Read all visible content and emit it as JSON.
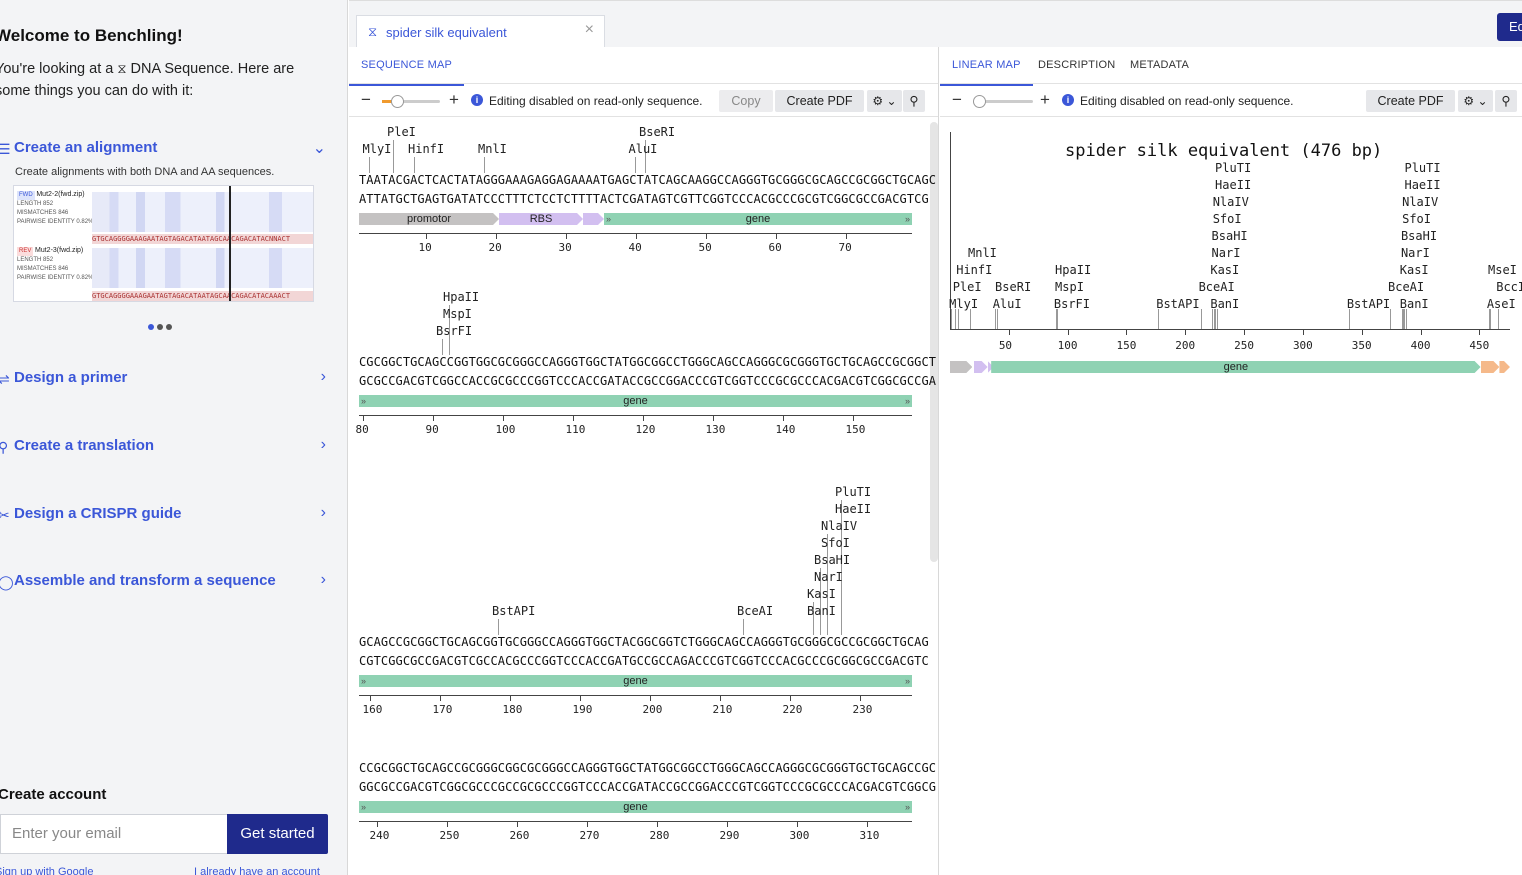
{
  "left": {
    "welcome": "Welcome to Benchling!",
    "intro_pre": "You're looking at a",
    "intro_icon": "dna-sequence-icon",
    "intro_post": "DNA Sequence. Here are some things you can do with it:",
    "workflows": [
      {
        "label": "Create an alignment",
        "expanded": true,
        "icon": "alignment-icon"
      },
      {
        "label": "Design a primer",
        "expanded": false,
        "icon": "primer-icon"
      },
      {
        "label": "Create a translation",
        "expanded": false,
        "icon": "translation-icon"
      },
      {
        "label": "Design a CRISPR guide",
        "expanded": false,
        "icon": "crispr-icon"
      },
      {
        "label": "Assemble and transform a sequence",
        "expanded": false,
        "icon": "assemble-icon"
      }
    ],
    "alignment_desc": "Create alignments with both DNA and AA sequences.",
    "alignment_preview": {
      "fwd_tag": "FWD",
      "fwd_name": "Mut2-2(fwd.zip)",
      "rev_tag": "REV",
      "rev_name": "Mut2-3(fwd.zip)",
      "length_label": "LENGTH",
      "fwd_length": "852",
      "rev_length": "852",
      "mismatches_label": "MISMATCHES",
      "fwd_mismatches": "846",
      "rev_mismatches": "846",
      "identity_label": "PAIRWISE IDENTITY",
      "fwd_identity": "0.82%",
      "rev_identity": "0.82%",
      "fwd_seq": "GTGCAGGGGAAAGAATAGTAGACATAATAGCAACAGACATACNNACT",
      "rev_seq": "GTGCAGGGGAAAGAATAGTAGACATAATAGCAACAGACATACAAACT"
    },
    "create_account": "Create account",
    "email_placeholder": "Enter your email",
    "get_started": "Get started",
    "signup_google": "Sign up with Google",
    "already": "I already have an account"
  },
  "tabs": [
    {
      "label": "spider silk equivalent",
      "icon": "dna-sequence-icon"
    }
  ],
  "edit_button": "Ed",
  "middle": {
    "subtabs": [
      "SEQUENCE MAP"
    ],
    "read_only": "Editing disabled on read-only sequence.",
    "copy": "Copy",
    "create_pdf": "Create PDF",
    "rows": [
      {
        "enzymes": [
          {
            "name": "PleI",
            "level": 1,
            "pos": 4
          },
          {
            "name": "MlyI",
            "level": 0,
            "pos": 0.5
          },
          {
            "name": "HinfI",
            "level": 0,
            "pos": 7
          },
          {
            "name": "MnlI",
            "level": 0,
            "pos": 17
          },
          {
            "name": "BseRI",
            "level": 1,
            "pos": 40
          },
          {
            "name": "AluI",
            "level": 0,
            "pos": 38.5
          }
        ],
        "top": "TAATACGACTCACTATAGGGAAAGAGGAGAAAATGAGCTATCAGCAAGGCCAGGGTGCGGGCGCAGCCGCGGCTGCAGC",
        "bottom": "ATTATGCTGAGTGATATCCCTTTCTCCTCTTTTACTCGATAGTCGTTCGGTCCCACGCCCGCGTCGGCGCCGACGTCG",
        "features": [
          {
            "label": "promotor",
            "kind": "promotor",
            "start": 0,
            "end": 20
          },
          {
            "label": "RBS",
            "kind": "rbs",
            "start": 20,
            "end": 32
          },
          {
            "label": "",
            "kind": "mini",
            "start": 32,
            "end": 35
          },
          {
            "label": "gene",
            "kind": "gene",
            "start": 35,
            "end": 79
          }
        ],
        "ticks": [
          10,
          20,
          30,
          40,
          50,
          60,
          70
        ],
        "first": 1
      },
      {
        "enzymes": [
          {
            "name": "HpaII",
            "level": 2,
            "pos": 12
          },
          {
            "name": "MspI",
            "level": 1,
            "pos": 12
          },
          {
            "name": "BsrFI",
            "level": 0,
            "pos": 11
          }
        ],
        "top": "CGCGGCTGCAGCCGGTGGCGCGGGCCAGGGTGGCTATGGCGGCCTGGGCAGCCAGGGCGCGGGTGCTGCAGCCGCGGCT",
        "bottom": "GCGCCGACGTCGGCCACCGCGCCCGGTCCCACCGATACCGCCGGACCCGTCGGTCCCGCGCCCACGACGTCGGCGCCGA",
        "features": [
          {
            "label": "gene",
            "kind": "gene",
            "start": 0,
            "end": 79
          }
        ],
        "ticks": [
          80,
          90,
          100,
          110,
          120,
          130,
          140,
          150
        ],
        "first": 80
      },
      {
        "enzymes": [
          {
            "name": "PluTI",
            "level": 7,
            "pos": 68
          },
          {
            "name": "HaeII",
            "level": 6,
            "pos": 68
          },
          {
            "name": "NlaIV",
            "level": 5,
            "pos": 66
          },
          {
            "name": "SfoI",
            "level": 4,
            "pos": 66
          },
          {
            "name": "BsaHI",
            "level": 3,
            "pos": 65
          },
          {
            "name": "NarI",
            "level": 2,
            "pos": 65
          },
          {
            "name": "KasI",
            "level": 1,
            "pos": 64
          },
          {
            "name": "BstAPI",
            "level": 0,
            "pos": 19
          },
          {
            "name": "BceAI",
            "level": 0,
            "pos": 54
          },
          {
            "name": "BanI",
            "level": 0,
            "pos": 64
          }
        ],
        "top": "GCAGCCGCGGCTGCAGCGGTGCGGGCCAGGGTGGCTACGGCGGTCTGGGCAGCCAGGGTGCGGGCGCCGCGGCTGCAG",
        "bottom": "CGTCGGCGCCGACGTCGCCACGCCCGGTCCCACCGATGCCGCCAGACCCGTCGGTCCCACGCCCGCGGCGCCGACGTC",
        "features": [
          {
            "label": "gene",
            "kind": "gene",
            "start": 0,
            "end": 79
          }
        ],
        "ticks": [
          160,
          170,
          180,
          190,
          200,
          210,
          220,
          230
        ],
        "first": 159
      },
      {
        "enzymes": [],
        "top": "CCGCGGCTGCAGCCGCGGGCGGCGCGGGCCAGGGTGGCTATGGCGGCCTGGGCAGCCAGGGCGCGGGTGCTGCAGCCGC",
        "bottom": "GGCGCCGACGTCGGCGCCCGCCGCGCCCGGTCCCACCGATACCGCCGGACCCGTCGGTCCCGCGCCCACGACGTCGGCG",
        "features": [
          {
            "label": "gene",
            "kind": "gene",
            "start": 0,
            "end": 79
          }
        ],
        "ticks": [
          240,
          250,
          260,
          270,
          280,
          290,
          300,
          310
        ],
        "first": 238
      }
    ]
  },
  "right": {
    "subtabs": [
      "LINEAR MAP",
      "DESCRIPTION",
      "METADATA"
    ],
    "read_only": "Editing disabled on read-only sequence.",
    "create_pdf": "Create PDF",
    "title": "spider silk equivalent (476 bp)",
    "length": 476,
    "enzymes": [
      {
        "name": "MnlI",
        "level": 3,
        "pos": 17
      },
      {
        "name": "HinfI",
        "level": 2,
        "pos": 7
      },
      {
        "name": "PleI",
        "level": 1,
        "pos": 4
      },
      {
        "name": "MlyI",
        "level": 0,
        "pos": 1
      },
      {
        "name": "BseRI",
        "level": 1,
        "pos": 40
      },
      {
        "name": "AluI",
        "level": 0,
        "pos": 38
      },
      {
        "name": "HpaII",
        "level": 2,
        "pos": 91
      },
      {
        "name": "MspI",
        "level": 1,
        "pos": 91
      },
      {
        "name": "BsrFI",
        "level": 0,
        "pos": 90
      },
      {
        "name": "BstAPI",
        "level": 0,
        "pos": 177
      },
      {
        "name": "PluTI",
        "level": 8,
        "pos": 227
      },
      {
        "name": "HaeII",
        "level": 7,
        "pos": 227
      },
      {
        "name": "NlaIV",
        "level": 6,
        "pos": 225
      },
      {
        "name": "SfoI",
        "level": 5,
        "pos": 225
      },
      {
        "name": "BsaHI",
        "level": 4,
        "pos": 224
      },
      {
        "name": "NarI",
        "level": 3,
        "pos": 224
      },
      {
        "name": "KasI",
        "level": 2,
        "pos": 223
      },
      {
        "name": "BceAI",
        "level": 1,
        "pos": 213
      },
      {
        "name": "BanI",
        "level": 0,
        "pos": 223
      },
      {
        "name": "BstAPI",
        "level": 0,
        "pos": 339
      },
      {
        "name": "PluTI",
        "level": 8,
        "pos": 388
      },
      {
        "name": "HaeII",
        "level": 7,
        "pos": 388
      },
      {
        "name": "NlaIV",
        "level": 6,
        "pos": 386
      },
      {
        "name": "SfoI",
        "level": 5,
        "pos": 386
      },
      {
        "name": "BsaHI",
        "level": 4,
        "pos": 385
      },
      {
        "name": "NarI",
        "level": 3,
        "pos": 385
      },
      {
        "name": "KasI",
        "level": 2,
        "pos": 384
      },
      {
        "name": "BceAI",
        "level": 1,
        "pos": 374
      },
      {
        "name": "BanI",
        "level": 0,
        "pos": 384
      },
      {
        "name": "MseI",
        "level": 2,
        "pos": 459
      },
      {
        "name": "BccI",
        "level": 1,
        "pos": 466
      },
      {
        "name": "AseI",
        "level": 0,
        "pos": 458
      }
    ],
    "ticks": [
      50,
      100,
      150,
      200,
      250,
      300,
      350,
      400,
      450
    ],
    "features": [
      {
        "label": "",
        "color": "#c4c2c2",
        "start": 0,
        "end": 19
      },
      {
        "label": "",
        "color": "#d2bff0",
        "start": 20,
        "end": 32
      },
      {
        "label": "",
        "color": "#d2bff0",
        "start": 32,
        "end": 35
      },
      {
        "label": "gene",
        "color": "#8fd2b3",
        "start": 35,
        "end": 451
      },
      {
        "label": "",
        "color": "#f5b98a",
        "start": 451,
        "end": 467
      },
      {
        "label": "",
        "color": "#f5b98a",
        "start": 467,
        "end": 476
      }
    ]
  }
}
